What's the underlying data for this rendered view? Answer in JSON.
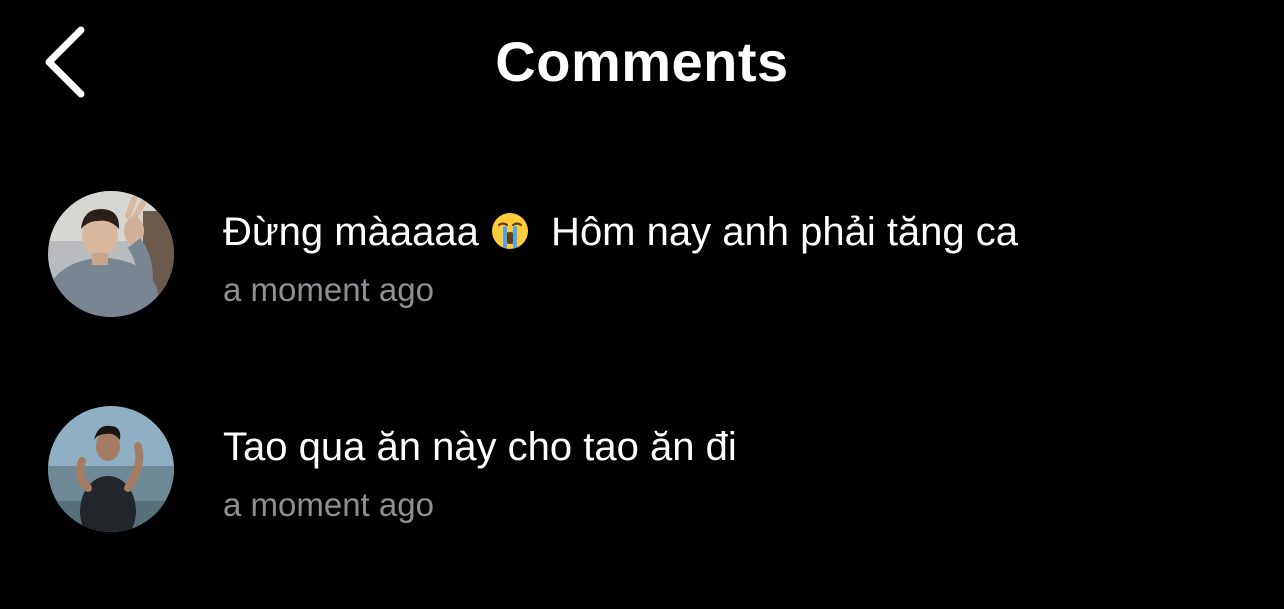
{
  "header": {
    "title": "Comments",
    "back_icon": "chevron-left-icon"
  },
  "comments": [
    {
      "text_before_emoji": "Đừng màaaaa ",
      "emoji": "loudly-crying-face-icon",
      "text_after_emoji": " Hôm nay anh phải tăng ca",
      "timestamp": "a moment ago"
    },
    {
      "text": "Tao qua ăn này cho tao ăn đi",
      "timestamp": "a moment ago"
    }
  ],
  "colors": {
    "background": "#000000",
    "text": "#ffffff",
    "timestamp": "#8e8e93"
  }
}
